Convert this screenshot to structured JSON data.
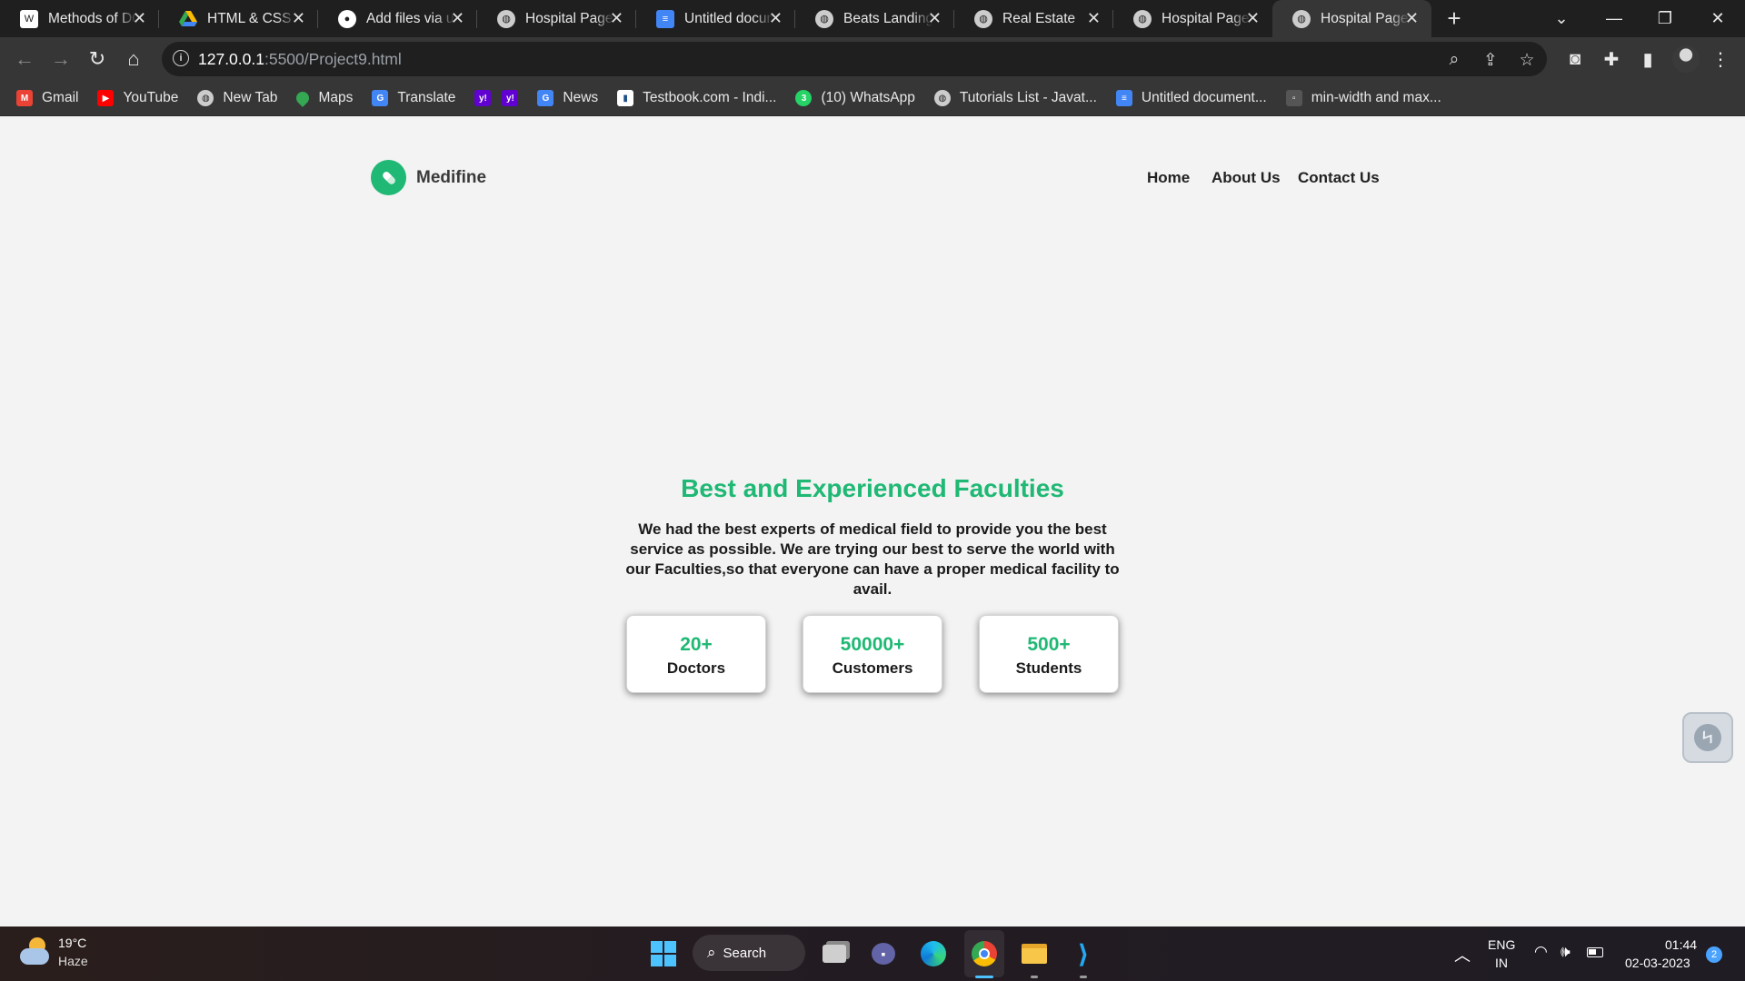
{
  "browser": {
    "tabs": [
      {
        "title": "Methods of DOM",
        "icon": "wordpress-icon",
        "color": "#ffffff"
      },
      {
        "title": "HTML & CSS Projects",
        "icon": "google-drive-icon",
        "color": "#f4b400"
      },
      {
        "title": "Add files via upload",
        "icon": "github-icon",
        "color": "#ffffff"
      },
      {
        "title": "Hospital Page",
        "icon": "globe-icon",
        "color": "#cccccc"
      },
      {
        "title": "Untitled document",
        "icon": "google-docs-icon",
        "color": "#4285f4"
      },
      {
        "title": "Beats Landing",
        "icon": "globe-icon",
        "color": "#cccccc"
      },
      {
        "title": "Real Estate",
        "icon": "globe-icon",
        "color": "#cccccc"
      },
      {
        "title": "Hospital Page",
        "icon": "globe-icon",
        "color": "#cccccc"
      },
      {
        "title": "Hospital Page",
        "icon": "globe-icon",
        "color": "#cccccc",
        "active": true
      }
    ],
    "new_tab_label": "+",
    "url_host": "127.0.0.1",
    "url_rest": ":5500/Project9.html",
    "bookmarks": [
      {
        "label": "Gmail",
        "icon": "gmail-icon",
        "color": "#ea4335"
      },
      {
        "label": "YouTube",
        "icon": "youtube-icon",
        "color": "#ff0000"
      },
      {
        "label": "New Tab",
        "icon": "globe-icon",
        "color": "#cccccc"
      },
      {
        "label": "Maps",
        "icon": "maps-icon",
        "color": "#34a853"
      },
      {
        "label": "Translate",
        "icon": "translate-icon",
        "color": "#4285f4"
      },
      {
        "label": "",
        "icon": "yahoo-icon",
        "color": "#6001d2"
      },
      {
        "label": "",
        "icon": "yahoo-icon",
        "color": "#6001d2"
      },
      {
        "label": "News",
        "icon": "news-icon",
        "color": "#4285f4"
      },
      {
        "label": "Testbook.com - Indi...",
        "icon": "testbook-icon",
        "color": "#ffffff"
      },
      {
        "label": "(10) WhatsApp",
        "icon": "whatsapp-icon",
        "color": "#25d366"
      },
      {
        "label": "Tutorials List - Javat...",
        "icon": "globe-icon",
        "color": "#cccccc"
      },
      {
        "label": "Untitled document...",
        "icon": "google-docs-icon",
        "color": "#4285f4"
      },
      {
        "label": "min-width and max...",
        "icon": "bookmark-page-icon",
        "color": "#555555"
      }
    ]
  },
  "site": {
    "brand": "Medifine",
    "nav": [
      "Home",
      "About Us",
      "Contact Us"
    ],
    "title": "Best and Experienced Faculties",
    "description": "We had the best experts of medical field to provide you the best service as possible. We are trying our best to serve the world with our Faculties,so that everyone can have a proper medical facility to avail.",
    "stats": [
      {
        "value": "20+",
        "label": "Doctors"
      },
      {
        "value": "50000+",
        "label": "Customers"
      },
      {
        "value": "500+",
        "label": "Students"
      }
    ],
    "accent_color": "#1fb874"
  },
  "taskbar": {
    "temperature": "19°C",
    "weather": "Haze",
    "search_label": "Search",
    "language_top": "ENG",
    "language_bottom": "IN",
    "time": "01:44",
    "date": "02-03-2023",
    "notification_count": "2"
  }
}
